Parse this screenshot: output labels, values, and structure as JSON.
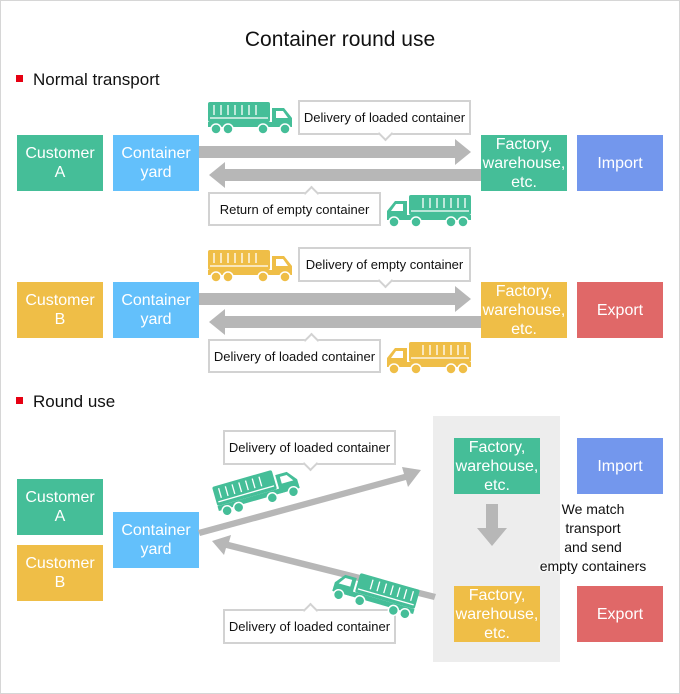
{
  "title": "Container round use",
  "colors": {
    "customer_a": "#45be98",
    "customer_b": "#efbe47",
    "container_yard": "#63c0fb",
    "import": "#7397ed",
    "export": "#e06868",
    "arrow": "#b7b7b7",
    "bullet": "#e60012"
  },
  "normal": {
    "heading": "Normal transport",
    "row_a": {
      "customer": "Customer\nA",
      "yard": "Container\nyard",
      "factory": "Factory,\nwarehouse,\netc.",
      "trade": "Import",
      "top_label": "Delivery of loaded container",
      "bottom_label": "Return of empty container",
      "truck_icon": "truck-icon"
    },
    "row_b": {
      "customer": "Customer\nB",
      "yard": "Container\nyard",
      "factory": "Factory,\nwarehouse,\netc.",
      "trade": "Export",
      "top_label": "Delivery of empty container",
      "bottom_label": "Delivery of loaded container",
      "truck_icon": "truck-icon"
    }
  },
  "round": {
    "heading": "Round use",
    "customer_a": "Customer\nA",
    "customer_b": "Customer\nB",
    "yard": "Container\nyard",
    "factory_top": "Factory,\nwarehouse,\netc.",
    "factory_bottom": "Factory,\nwarehouse,\netc.",
    "import": "Import",
    "export": "Export",
    "top_label": "Delivery of loaded container",
    "bottom_label": "Delivery of loaded container",
    "note": "We match\ntransport\nand send\nempty containers",
    "truck_icon": "truck-icon"
  }
}
